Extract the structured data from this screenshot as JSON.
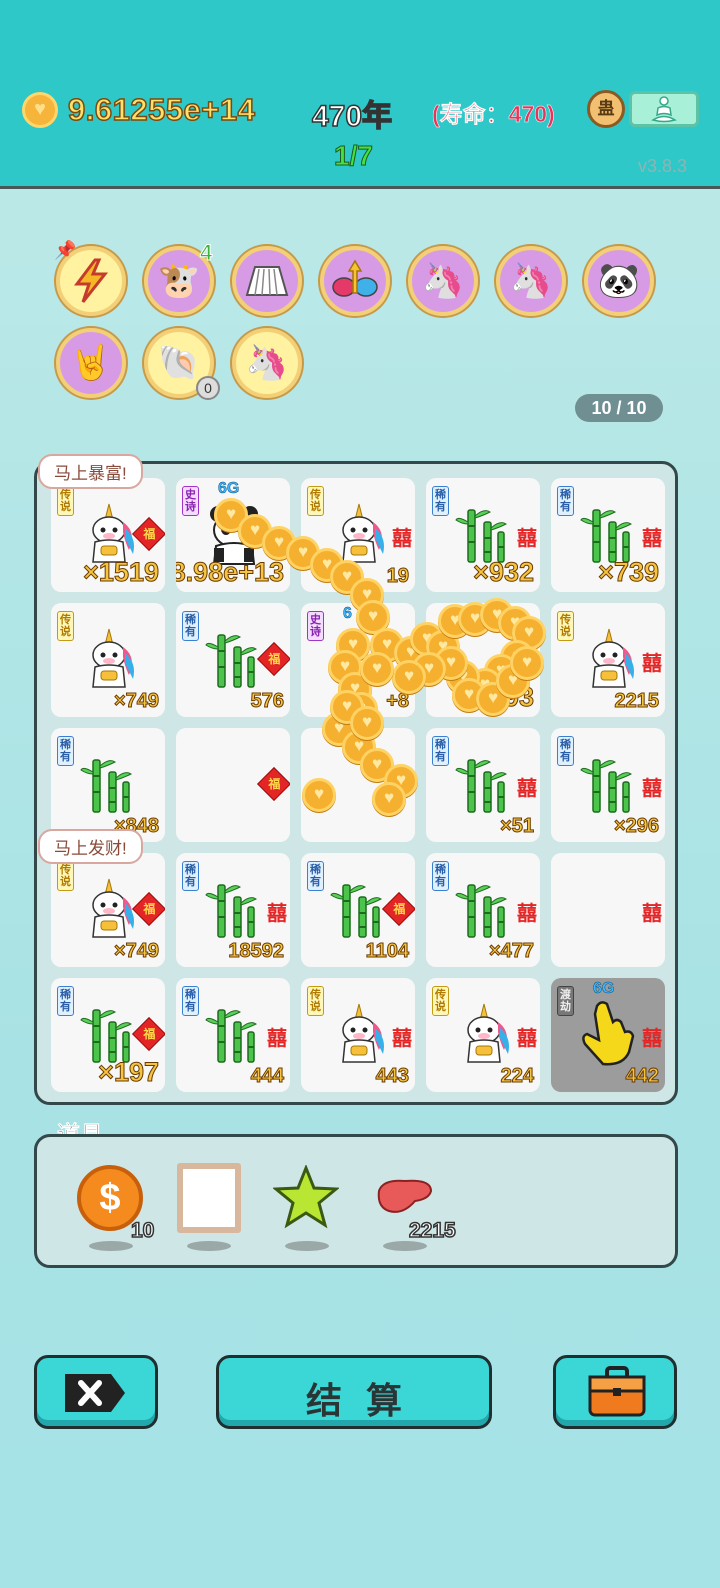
{
  "header": {
    "money": "9.61255e+14",
    "year": "470年",
    "lifespan": "(寿命：470)",
    "progress": "1/7",
    "version": "v3.8.3",
    "round_icon_text": "蛊"
  },
  "buffs": {
    "lightning_badge": "",
    "twins_count": "4",
    "shell_count": "0"
  },
  "capacity": "10 / 10",
  "board": {
    "bubble_top": "马上暴富!",
    "bubble_mid": "马上发财!",
    "cells": [
      {
        "tag": "传说",
        "value": "×1519"
      },
      {
        "tag": "史诗",
        "g": "6G",
        "value": "8.98e+13"
      },
      {
        "tag": "传说",
        "value": "19"
      },
      {
        "tag": "稀有",
        "value": "×932"
      },
      {
        "tag": "稀有",
        "value": "×739"
      },
      {
        "tag": "传说",
        "value": "×749"
      },
      {
        "tag": "稀有",
        "value": "576"
      },
      {
        "tag": "史诗",
        "g": "6",
        "value": "+8"
      },
      {
        "tag": "",
        "value": "×193"
      },
      {
        "tag": "传说",
        "value": "2215"
      },
      {
        "tag": "稀有",
        "value": "×848"
      },
      {
        "tag": "",
        "value": ""
      },
      {
        "tag": "",
        "value": ""
      },
      {
        "tag": "稀有",
        "value": "×51"
      },
      {
        "tag": "稀有",
        "value": "×296"
      },
      {
        "tag": "传说",
        "value": "×749"
      },
      {
        "tag": "稀有",
        "value": "18592"
      },
      {
        "tag": "稀有",
        "value": "1104"
      },
      {
        "tag": "稀有",
        "value": "×477"
      },
      {
        "tag": "",
        "value": ""
      },
      {
        "tag": "稀有",
        "value": "×197"
      },
      {
        "tag": "稀有",
        "value": "444"
      },
      {
        "tag": "传说",
        "value": "443"
      },
      {
        "tag": "传说",
        "value": "224"
      },
      {
        "tag": "渡劫",
        "g": "6G",
        "value": "442"
      }
    ]
  },
  "props": {
    "label": "道具",
    "coin_count": "10",
    "liver_count": "2215"
  },
  "buttons": {
    "settle": "结算"
  },
  "colors": {
    "header_bg": "#2ec8c8",
    "money": "#ffe06a",
    "lifespan": "#e8335a",
    "progress": "#43e243",
    "value_text": "#f5c542"
  }
}
